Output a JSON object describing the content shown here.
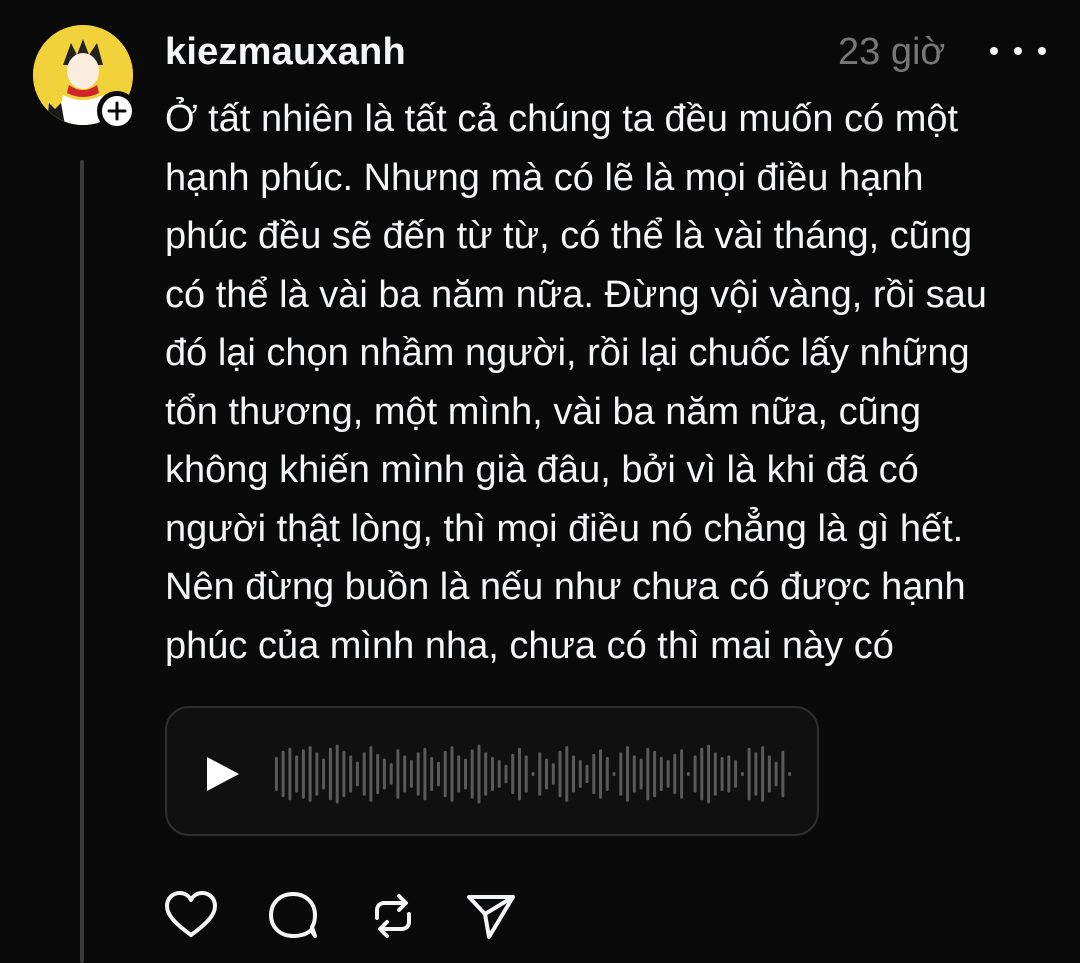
{
  "post": {
    "username": "kiezmauxanh",
    "timestamp": "23 giờ",
    "text": "Ở tất nhiên là tất cả chúng ta đều muốn có một\nhạnh phúc. Nhưng mà có lẽ là mọi điều hạnh\nphúc đều sẽ đến từ từ, có thể là vài tháng, cũng\ncó thể là vài ba năm nữa. Đừng vội vàng, rồi sau\nđó lại chọn nhầm người, rồi lại chuốc lấy những\ntổn thương, một mình, vài ba năm nữa, cũng\nkhông khiến mình già đâu, bởi vì là khi đã có\nngười thật lòng, thì mọi điều nó chẳng là gì hết.\nNên đừng buồn là nếu như chưa có được hạnh\nphúc của mình nha, chưa có thì mai này có",
    "avatar_bg": "#f2d23a"
  },
  "icons": {
    "follow": "plus-icon",
    "more": "more-icon",
    "play": "play-icon",
    "like": "heart-icon",
    "reply": "comment-icon",
    "repost": "repost-icon",
    "share": "send-icon"
  },
  "colors": {
    "background": "#0a0a0a",
    "text": "#f3f5f7",
    "muted": "#777777",
    "waveform": "#5a5a5a",
    "thread_line": "#3a3a3a"
  }
}
